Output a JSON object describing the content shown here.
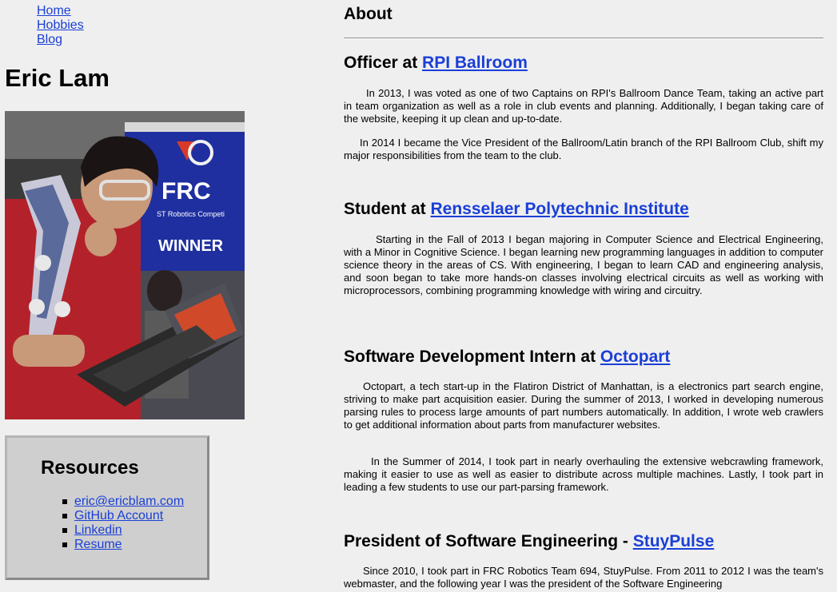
{
  "nav": {
    "items": [
      "Home",
      "Hobbies",
      "Blog"
    ]
  },
  "site_name": "Eric Lam",
  "photo": {
    "alt": "Eric Lam at FRC Robotics competition"
  },
  "resources": {
    "title": "Resources",
    "links": [
      "eric@ericblam.com",
      "GitHub Account",
      "Linkedin",
      "Resume"
    ]
  },
  "about": {
    "title": "About",
    "sections": [
      {
        "prefix": "Officer at ",
        "link": "RPI Ballroom",
        "paragraphs": [
          "In 2013, I was voted as one of two Captains on RPI's Ballroom Dance Team, taking an active part in team organization as well as a role in club events and planning. Additionally, I began taking care of the website, keeping it up clean and up-to-date.",
          "In 2014 I became the Vice President of the Ballroom/Latin branch of the RPI Ballroom Club, shift my major responsibilities from the team to the club."
        ]
      },
      {
        "prefix": "Student at ",
        "link": "Rensselaer Polytechnic Institute",
        "paragraphs": [
          "Starting in the Fall of 2013 I began majoring in Computer Science and Electrical Engineering, with a Minor in Cognitive Science. I began learning new programming languages in addition to computer science theory in the areas of CS. With engineering, I began to learn CAD and engineering analysis, and soon began to take more hands-on classes involving electrical circuits as well as working with microprocessors, combining programming knowledge with wiring and circuitry."
        ]
      },
      {
        "prefix": "Software Development Intern at ",
        "link": "Octopart",
        "paragraphs": [
          "Octopart, a tech start-up in the Flatiron District of Manhattan, is a electronics part search engine, striving to make part acquisition easier. During the summer of 2013, I worked in developing numerous parsing rules to process large amounts of part numbers automatically. In addition, I wrote web crawlers to get additional information about parts from manufacturer websites.",
          "In the Summer of 2014, I took part in nearly overhauling the extensive webcrawling framework, making it easier to use as well as easier to distribute across multiple machines. Lastly, I took part in leading a few students to use our part-parsing framework."
        ]
      },
      {
        "prefix": "President of Software Engineering - ",
        "link": "StuyPulse",
        "paragraphs": [
          "Since 2010, I took part in FRC Robotics Team 694, StuyPulse. From 2011 to 2012 I was the team's webmaster, and the following year I was the president of the Software Engineering"
        ]
      }
    ]
  },
  "colors": {
    "background": "#efefef",
    "link": "#1a3fd6",
    "resources_box": "#cfcfcf"
  }
}
